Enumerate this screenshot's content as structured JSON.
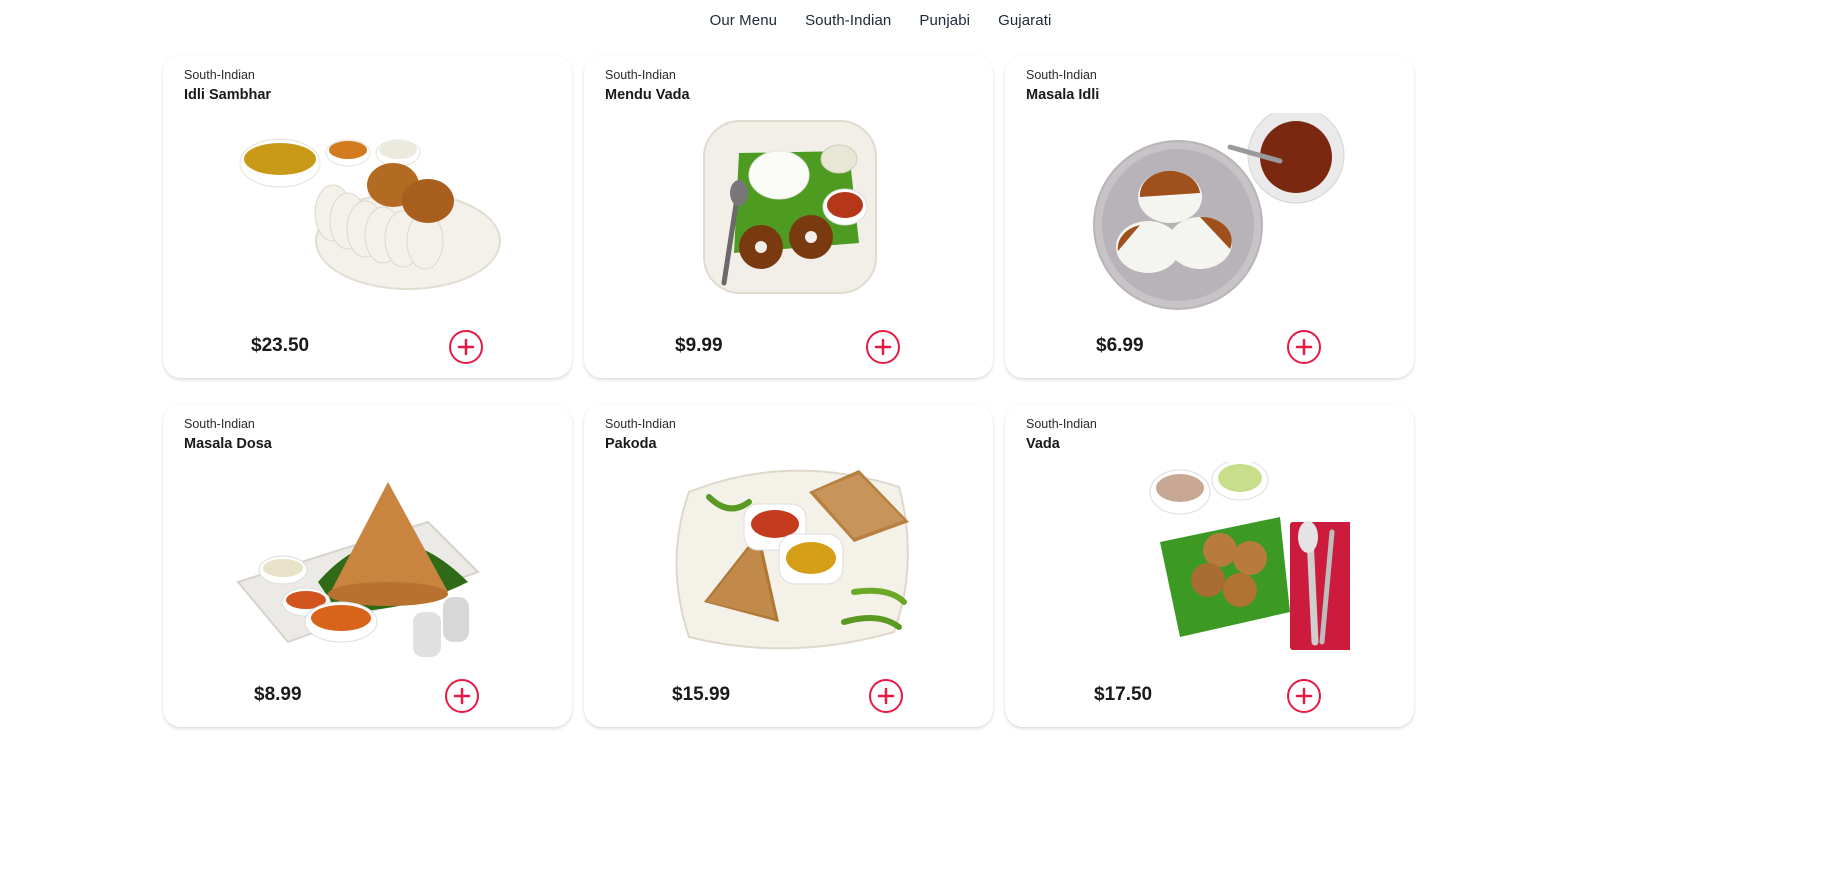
{
  "nav": {
    "items": [
      "Our Menu",
      "South-Indian",
      "Punjabi",
      "Gujarati"
    ]
  },
  "colors": {
    "accent": "#e51b46",
    "card_bg": "#ffffff",
    "text": "#1a1a1a"
  },
  "menu": [
    {
      "category": "South-Indian",
      "name": "Idli Sambhar",
      "price": "$23.50",
      "image": "idli-sambhar-photo"
    },
    {
      "category": "South-Indian",
      "name": "Mendu Vada",
      "price": "$9.99",
      "image": "mendu-vada-photo"
    },
    {
      "category": "South-Indian",
      "name": "Masala Idli",
      "price": "$6.99",
      "image": "masala-idli-photo"
    },
    {
      "category": "South-Indian",
      "name": "Masala Dosa",
      "price": "$8.99",
      "image": "masala-dosa-photo"
    },
    {
      "category": "South-Indian",
      "name": "Pakoda",
      "price": "$15.99",
      "image": "pakoda-photo"
    },
    {
      "category": "South-Indian",
      "name": "Vada",
      "price": "$17.50",
      "image": "vada-photo"
    }
  ],
  "icons": {
    "add": "plus-circle-icon"
  }
}
